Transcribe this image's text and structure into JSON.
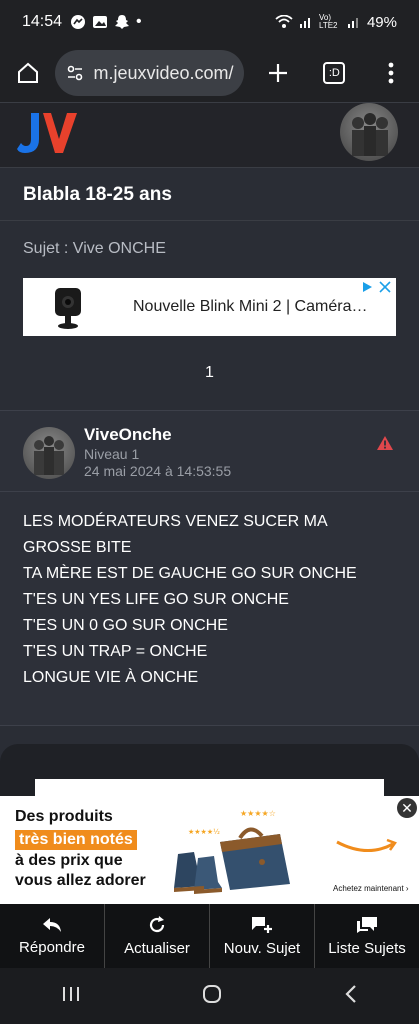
{
  "status": {
    "time": "14:54",
    "battery": "49%",
    "network": "Vo) LTE2"
  },
  "browser": {
    "url": "m.jeuxvideo.com/",
    "tab_label": ":D"
  },
  "forum": {
    "title": "Blabla 18-25 ans",
    "subject": "Sujet : Vive ONCHE",
    "page": "1"
  },
  "ad_banner": {
    "text": "Nouvelle Blink Mini 2 | Caméra…"
  },
  "post": {
    "author": "ViveOnche",
    "level": "Niveau 1",
    "date": "24 mai 2024 à 14:53:55",
    "lines": [
      "LES MODÉRATEURS VENEZ SUCER MA",
      "GROSSE BITE",
      "TA MÈRE EST DE GAUCHE GO SUR ONCHE",
      "T'ES UN YES LIFE GO SUR ONCHE",
      "T'ES UN 0 GO SUR ONCHE",
      "T'ES UN TRAP = ONCHE",
      "LONGUE VIE À ONCHE"
    ]
  },
  "amazon_ad": {
    "line1": "Des produits",
    "line2": "très bien notés",
    "line3": "à des prix que",
    "line4": "vous allez adorer",
    "cta": "Achetez maintenant ›"
  },
  "actions": {
    "reply": "Répondre",
    "refresh": "Actualiser",
    "new_topic": "Nouv. Sujet",
    "topic_list": "Liste Sujets"
  },
  "colors": {
    "accent_warn": "#e0474c",
    "amazon_orange": "#f08c1c"
  }
}
